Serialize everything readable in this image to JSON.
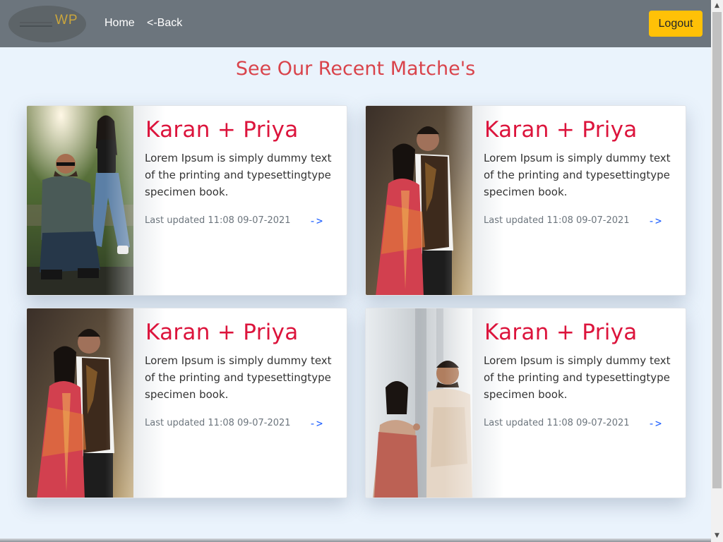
{
  "header": {
    "logo_text": "WP",
    "nav": {
      "home": "Home",
      "back": "<-Back"
    },
    "logout_label": "Logout"
  },
  "main": {
    "title": "See Our Recent Matche's",
    "cards": [
      {
        "title": "Karan + Priya",
        "text": "Lorem Ipsum is simply dummy text of the printing and typesettingtype specimen book.",
        "updated": "Last updated 11:08 09-07-2021",
        "link": "->"
      },
      {
        "title": "Karan + Priya",
        "text": "Lorem Ipsum is simply dummy text of the printing and typesettingtype specimen book.",
        "updated": "Last updated 11:08 09-07-2021",
        "link": "->"
      },
      {
        "title": "Karan + Priya",
        "text": "Lorem Ipsum is simply dummy text of the printing and typesettingtype specimen book.",
        "updated": "Last updated 11:08 09-07-2021",
        "link": "->"
      },
      {
        "title": "Karan + Priya",
        "text": "Lorem Ipsum is simply dummy text of the printing and typesettingtype specimen book.",
        "updated": "Last updated 11:08 09-07-2021",
        "link": "->"
      }
    ]
  },
  "colors": {
    "navbar": "#6c757d",
    "accent_button": "#ffc107",
    "title": "#d9434b",
    "card_title": "#dc143c",
    "link": "#1a5cff",
    "background": "#eaf3fc"
  }
}
